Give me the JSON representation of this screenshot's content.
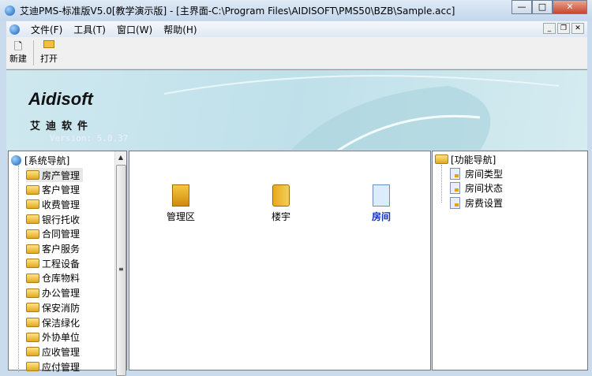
{
  "window": {
    "title": "艾迪PMS-标准版V5.0[教学演示版] - [主界面-C:\\Program Files\\AIDISOFT\\PMS50\\BZB\\Sample.acc]",
    "min": "—",
    "max": "□",
    "close": "✕"
  },
  "menu": [
    "文件(F)",
    "工具(T)",
    "窗口(W)",
    "帮助(H)"
  ],
  "mdi_buttons": [
    "_",
    "❐",
    "✕"
  ],
  "toolbar": [
    {
      "label": "新建",
      "icon": "new-file-icon"
    },
    {
      "label": "打开",
      "icon": "open-folder-icon"
    }
  ],
  "banner": {
    "logo": "Aidisoft",
    "cn": "艾迪软件",
    "version": "Version: 5.0.37"
  },
  "left_tree": {
    "root": "[系统导航]",
    "items": [
      "房产管理",
      "客户管理",
      "收费管理",
      "银行托收",
      "合同管理",
      "客户服务",
      "工程设备",
      "仓库物料",
      "办公管理",
      "保安消防",
      "保洁绿化",
      "外协单位",
      "应收管理",
      "应付管理"
    ],
    "selected": "房产管理"
  },
  "center": {
    "icons": [
      {
        "label": "管理区"
      },
      {
        "label": "楼宇"
      },
      {
        "label": "房间"
      }
    ]
  },
  "right_tree": {
    "root": "[功能导航]",
    "items": [
      "房间类型",
      "房间状态",
      "房费设置"
    ]
  }
}
